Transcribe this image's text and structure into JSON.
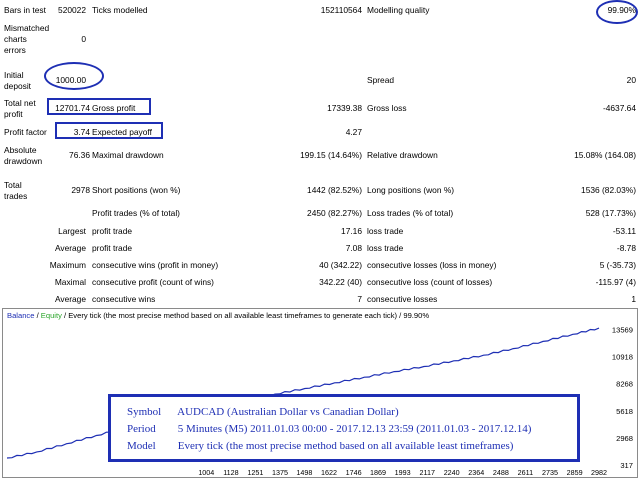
{
  "stats": {
    "bars_in_test_label": "Bars in test",
    "bars_in_test_value": "520022",
    "ticks_modelled_label": "Ticks modelled",
    "ticks_modelled_value": "152110564",
    "modelling_quality_label": "Modelling quality",
    "modelling_quality_value": "99.90%",
    "mismatched_label_1": "Mismatched",
    "mismatched_label_2": "charts",
    "mismatched_label_3": "errors",
    "mismatched_value": "0",
    "initial_deposit_label_1": "Initial",
    "initial_deposit_label_2": "deposit",
    "initial_deposit_value": "1000.00",
    "spread_label": "Spread",
    "spread_value": "20",
    "total_net_profit_label_1": "Total net",
    "total_net_profit_label_2": "profit",
    "total_net_profit_value": "12701.74",
    "gross_profit_label": "Gross profit",
    "gross_profit_value": "17339.38",
    "gross_loss_label": "Gross loss",
    "gross_loss_value": "-4637.64",
    "profit_factor_label": "Profit factor",
    "profit_factor_value": "3.74",
    "expected_payoff_label": "Expected payoff",
    "expected_payoff_value": "4.27",
    "absolute_drawdown_label_1": "Absolute",
    "absolute_drawdown_label_2": "drawdown",
    "absolute_drawdown_value": "76.36",
    "maximal_drawdown_label": "Maximal drawdown",
    "maximal_drawdown_value": "199.15 (14.64%)",
    "relative_drawdown_label": "Relative drawdown",
    "relative_drawdown_value": "15.08% (164.08)",
    "total_trades_label_1": "Total",
    "total_trades_label_2": "trades",
    "total_trades_value": "2978",
    "short_positions_label": "Short positions (won %)",
    "short_positions_value": "1442 (82.52%)",
    "long_positions_label": "Long positions (won %)",
    "long_positions_value": "1536 (82.03%)",
    "profit_trades_label": "Profit trades (% of total)",
    "profit_trades_value": "2450 (82.27%)",
    "loss_trades_label": "Loss trades (% of total)",
    "loss_trades_value": "528 (17.73%)",
    "largest_label": "Largest",
    "largest_profit_label": "profit trade",
    "largest_profit_value": "17.16",
    "largest_loss_label": "loss trade",
    "largest_loss_value": "-53.11",
    "average_label": "Average",
    "average_profit_label": "profit trade",
    "average_profit_value": "7.08",
    "average_loss_label": "loss trade",
    "average_loss_value": "-8.78",
    "maximum_label": "Maximum",
    "max_cons_wins_label": "consecutive wins (profit in money)",
    "max_cons_wins_value": "40 (342.22)",
    "max_cons_losses_label": "consecutive losses (loss in money)",
    "max_cons_losses_value": "5 (-35.73)",
    "maximal_label": "Maximal",
    "maximal_cons_profit_label": "consecutive profit (count of wins)",
    "maximal_cons_profit_value": "342.22 (40)",
    "maximal_cons_loss_label": "consecutive loss (count of losses)",
    "maximal_cons_loss_value": "-115.97 (4)",
    "average2_label": "Average",
    "avg_cons_wins_label": "consecutive wins",
    "avg_cons_wins_value": "7",
    "avg_cons_losses_label": "consecutive losses",
    "avg_cons_losses_value": "1"
  },
  "chart_header": {
    "balance": "Balance",
    "sep": " / ",
    "equity": "Equity",
    "rest": " / Every tick (the most precise method based on all available least timeframes to generate each tick) / 99.90%"
  },
  "chart_data": {
    "type": "line",
    "y_ticks": [
      "13569",
      "10918",
      "8268",
      "5618",
      "2968",
      "317"
    ],
    "x_ticks": [
      "1004",
      "1128",
      "1251",
      "1375",
      "1498",
      "1622",
      "1746",
      "1869",
      "1993",
      "2117",
      "2240",
      "2364",
      "2488",
      "2611",
      "2735",
      "2859",
      "2982"
    ],
    "ylim": [
      317,
      14200
    ],
    "xlim": [
      0,
      2982
    ],
    "series": [
      {
        "color": "#1e2fb4",
        "x": [
          0,
          150,
          300,
          450,
          600,
          750,
          900,
          1050,
          1200,
          1350,
          1500,
          1650,
          1800,
          1950,
          2100,
          2250,
          2400,
          2550,
          2700,
          2850,
          2982
        ],
        "y": [
          1000,
          1600,
          2400,
          3200,
          4000,
          4700,
          5400,
          6050,
          6650,
          7250,
          7800,
          8350,
          8900,
          9450,
          9950,
          10500,
          11050,
          11700,
          12400,
          13100,
          13700
        ]
      }
    ]
  },
  "info": {
    "symbol_key": "Symbol",
    "symbol_value": "AUDCAD (Australian Dollar vs Canadian Dollar)",
    "period_key": "Period",
    "period_value": "5 Minutes (M5) 2011.01.03 00:00 - 2017.12.13 23:59 (2011.01.03 - 2017.12.14)",
    "model_key": "Model",
    "model_value": "Every tick (the most precise method based on all available least timeframes)"
  },
  "colors": {
    "annotation": "#1e2fb4",
    "balance_line": "#1e2fb4",
    "equity_label": "#2aa52a"
  }
}
